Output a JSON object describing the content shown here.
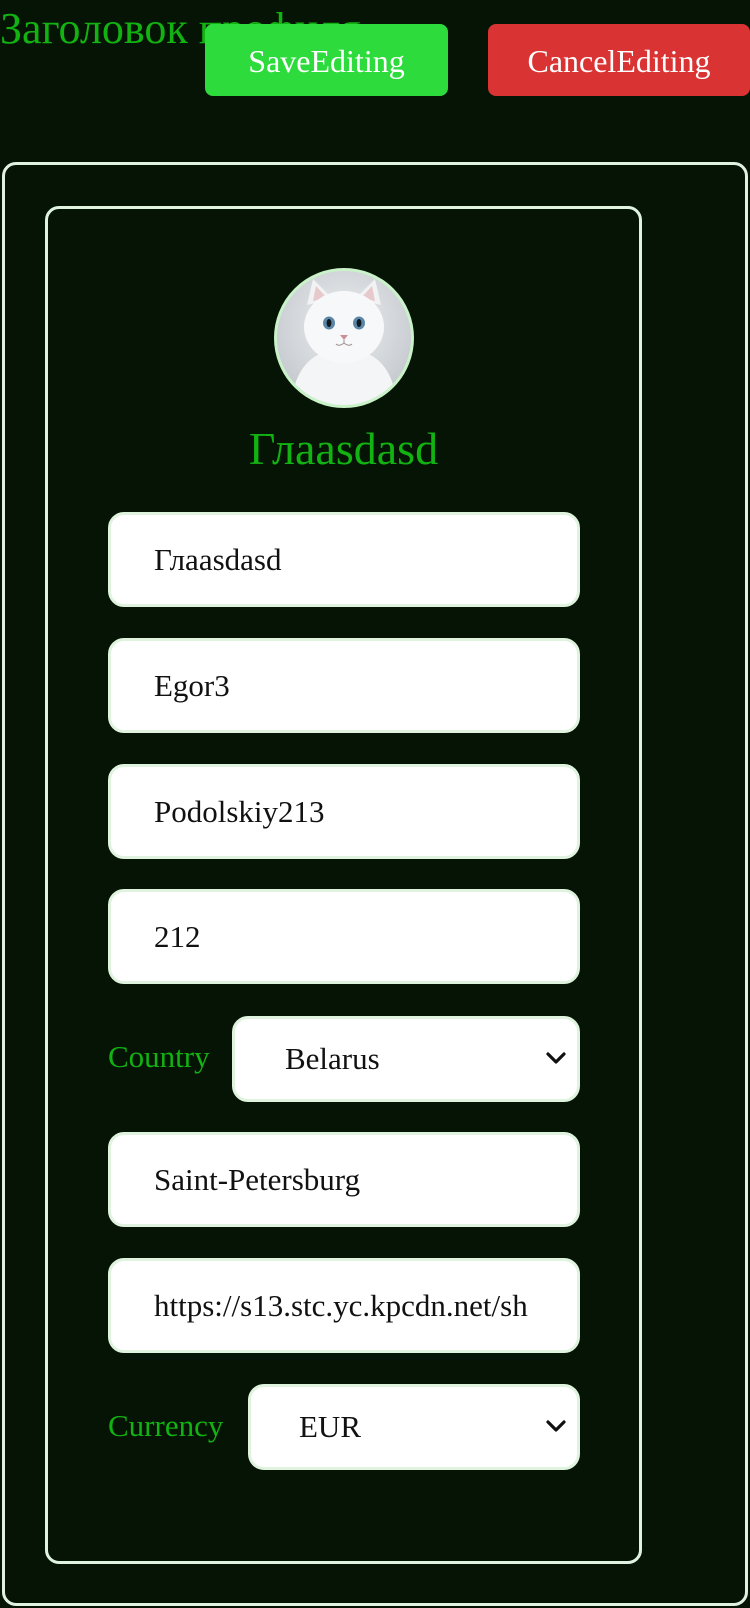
{
  "header": {
    "title": "Заголовок профиля",
    "save_label": "SaveEditing",
    "cancel_label": "CancelEditing"
  },
  "profile": {
    "display_name": "Глaasdasd",
    "avatar_alt": "white cat"
  },
  "form": {
    "field_1": "Глaasdasd",
    "field_2": "Egor3",
    "field_3": "Podolskiy213",
    "field_4": "212",
    "country_label": "Country",
    "country_value": "Belarus",
    "city": "Saint-Petersburg",
    "avatar_url": "https://s13.stc.yc.kpcdn.net/sh",
    "currency_label": "Currency",
    "currency_value": "EUR"
  },
  "colors": {
    "background": "#061405",
    "accent_text": "#12b212",
    "save_button": "#2edb3c",
    "cancel_button": "#da3333",
    "card_border": "#e0f3e0"
  },
  "icons": {
    "select_arrow": "chevron-down-icon"
  }
}
